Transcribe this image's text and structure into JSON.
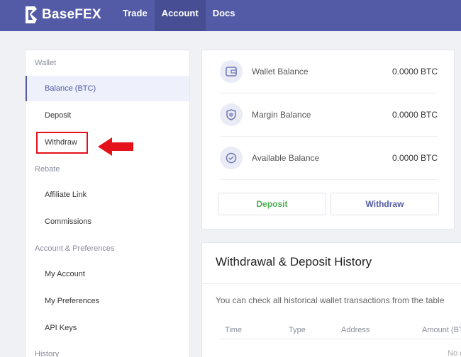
{
  "brand": {
    "name": "BaseFEX"
  },
  "nav": {
    "items": [
      "Trade",
      "Account",
      "Docs"
    ],
    "active": "Account"
  },
  "sidebar": {
    "groups": {
      "wallet": "Wallet",
      "rebate": "Rebate",
      "account": "Account & Preferences",
      "history": "History"
    },
    "items": {
      "balance": "Balance (BTC)",
      "deposit": "Deposit",
      "withdraw": "Withdraw",
      "affiliate": "Affiliate Link",
      "commissions": "Commissions",
      "my_account": "My Account",
      "my_preferences": "My Preferences",
      "api_keys": "API Keys"
    },
    "active": "Balance (BTC)"
  },
  "balances": [
    {
      "label": "Wallet Balance",
      "value": "0.0000 BTC",
      "icon": "wallet-icon"
    },
    {
      "label": "Margin Balance",
      "value": "0.0000 BTC",
      "icon": "shield-icon"
    },
    {
      "label": "Available Balance",
      "value": "0.0000 BTC",
      "icon": "check-circle-icon"
    }
  ],
  "buttons": {
    "deposit": "Deposit",
    "withdraw": "Withdraw"
  },
  "history": {
    "title": "Withdrawal & Deposit History",
    "description": "You can check all historical wallet transactions from the table",
    "columns": [
      "Time",
      "Type",
      "Address",
      "Amount (BT"
    ],
    "empty": "No c"
  },
  "colors": {
    "brand": "#535ba6",
    "deposit": "#4caf50",
    "highlight": "#e4101a"
  }
}
